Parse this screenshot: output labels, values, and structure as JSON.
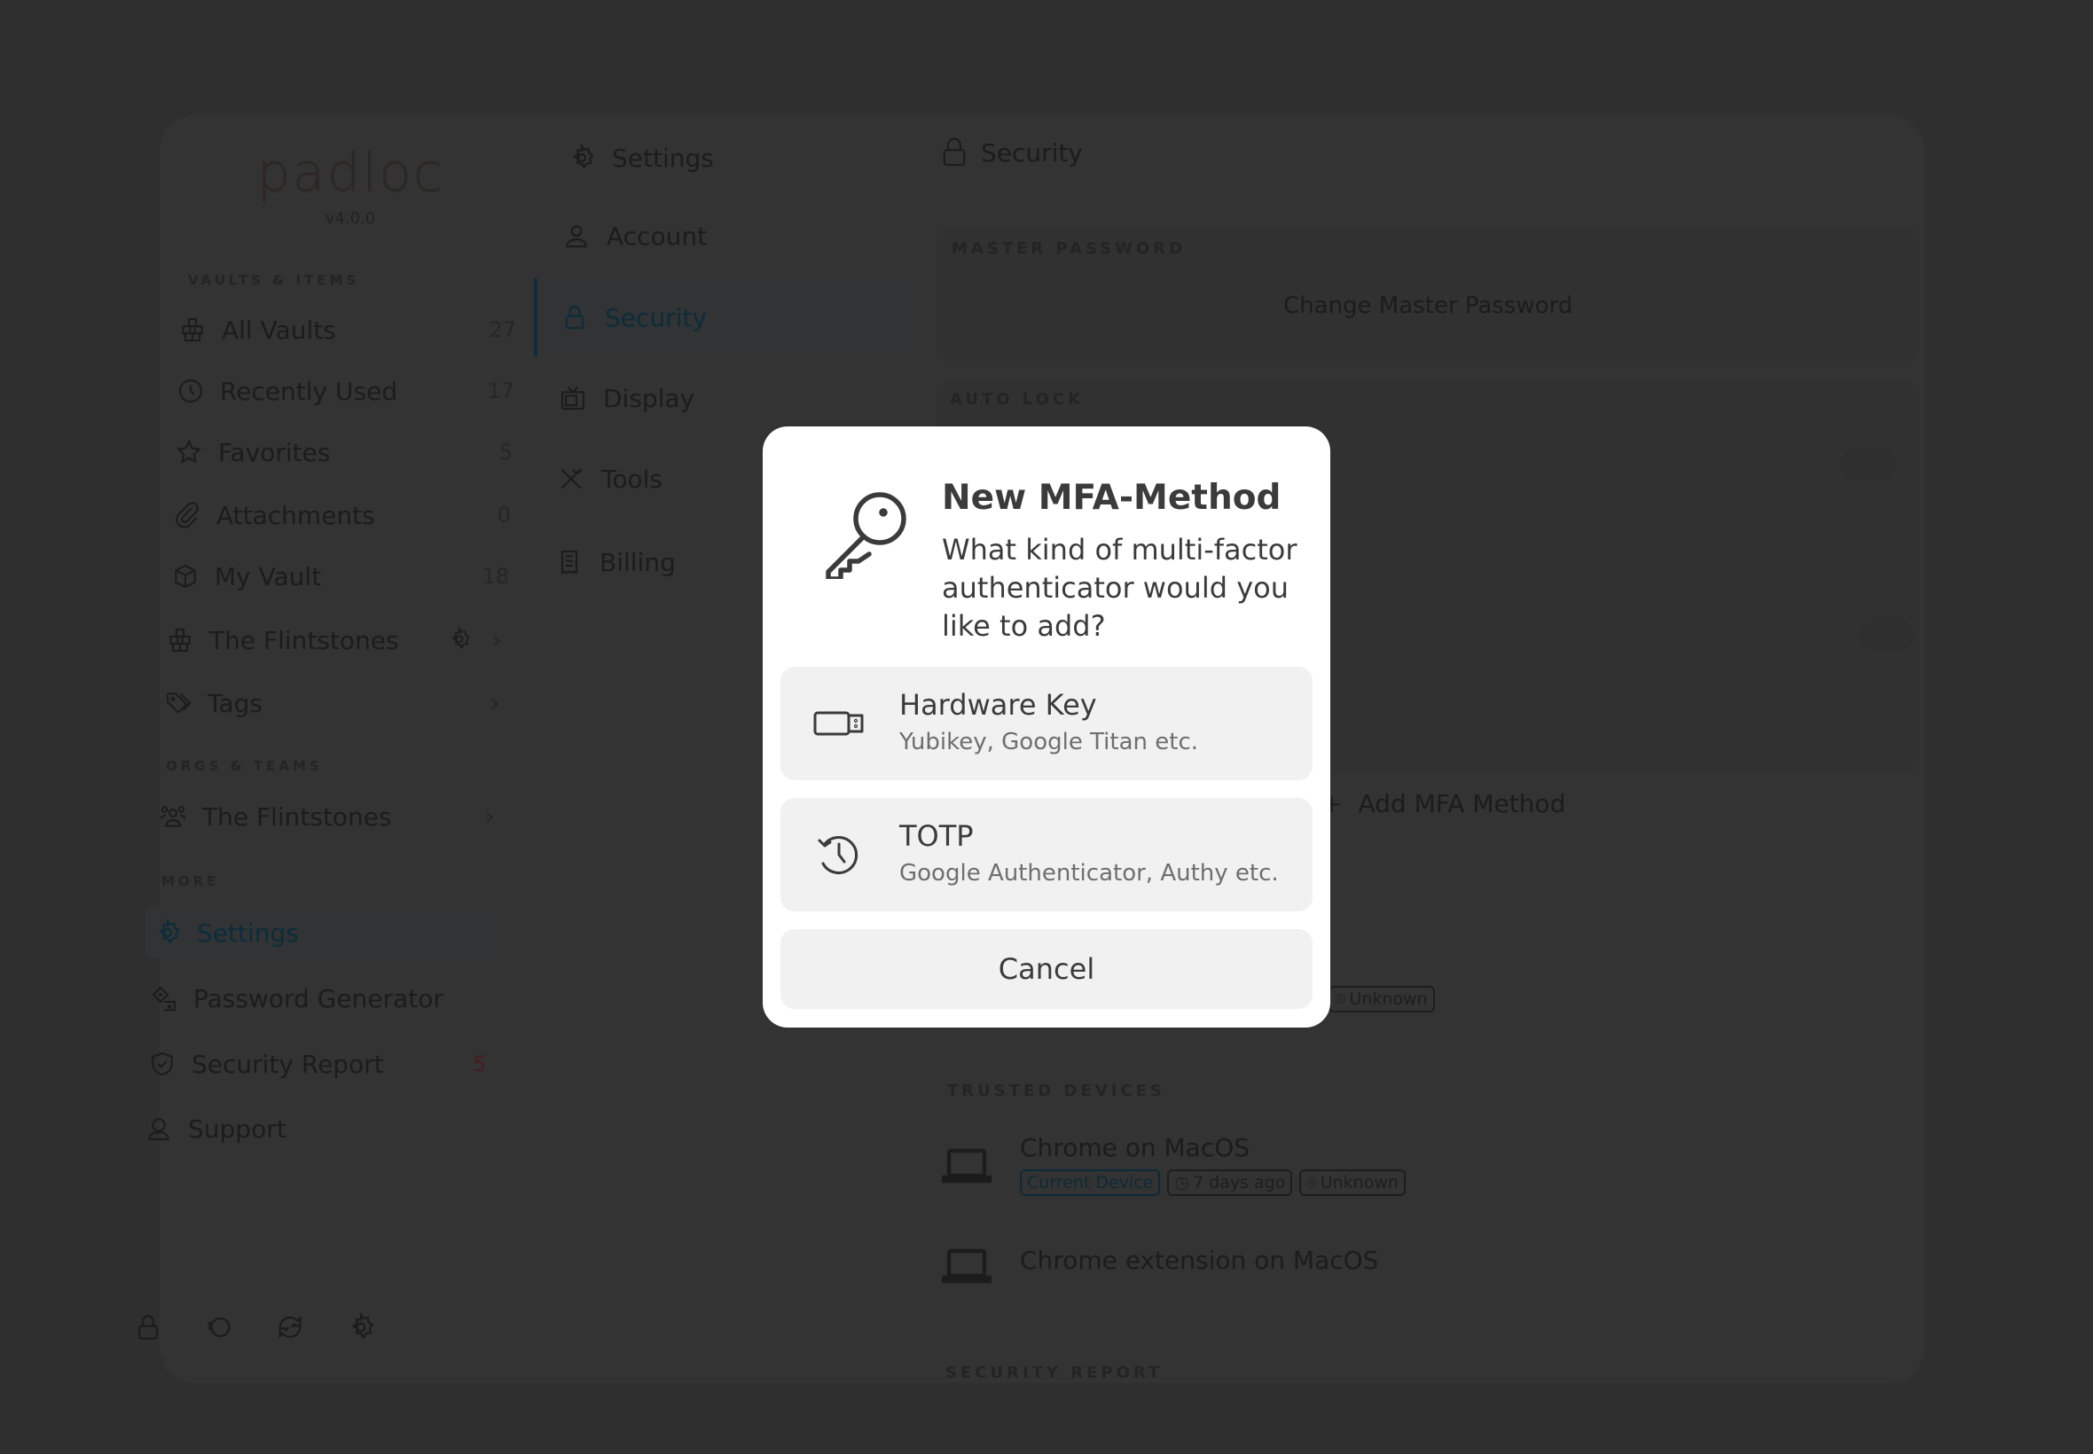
{
  "app": {
    "logo": "padloc",
    "version": "v4.0.0"
  },
  "sidebar": {
    "sections": {
      "vaults": "Vaults & Items",
      "orgs": "Orgs & Teams",
      "more": "More"
    },
    "items": [
      {
        "label": "All Vaults",
        "count": "27",
        "icon": "vaults-icon"
      },
      {
        "label": "Recently Used",
        "count": "17",
        "icon": "clock-icon"
      },
      {
        "label": "Favorites",
        "count": "5",
        "icon": "star-icon"
      },
      {
        "label": "Attachments",
        "count": "0",
        "icon": "paperclip-icon"
      },
      {
        "label": "My Vault",
        "count": "18",
        "icon": "cube-icon"
      },
      {
        "label": "The Flintstones",
        "icon": "vaults-icon"
      },
      {
        "label": "Tags",
        "icon": "tags-icon"
      },
      {
        "label": "The Flintstones",
        "icon": "group-icon"
      },
      {
        "label": "Settings",
        "icon": "gear-icon"
      },
      {
        "label": "Password Generator",
        "icon": "dice-icon"
      },
      {
        "label": "Security Report",
        "count": "5",
        "icon": "shield-check-icon"
      },
      {
        "label": "Support",
        "icon": "support-icon"
      }
    ],
    "chevron": "›",
    "security_count_color": "#4a1a1f"
  },
  "settings_nav": {
    "title": "Settings",
    "items": [
      {
        "label": "Account",
        "icon": "user-icon"
      },
      {
        "label": "Security",
        "icon": "lock-icon"
      },
      {
        "label": "Display",
        "icon": "tv-icon"
      },
      {
        "label": "Tools",
        "icon": "tools-icon"
      },
      {
        "label": "Billing",
        "icon": "receipt-icon"
      }
    ]
  },
  "security_page": {
    "title": "Security",
    "master_password_label": "Master Password",
    "change_master_password": "Change Master Password",
    "auto_lock_label": "Auto Lock",
    "add_mfa": "Add MFA Method",
    "add_mfa_prefix": "+",
    "mfa_badge_location": "Unknown",
    "trusted_devices_label": "Trusted Devices",
    "devices": [
      {
        "name": "Chrome on MacOS",
        "badges": {
          "current": "Current Device",
          "last_used": "7 days ago",
          "location": "Unknown"
        }
      },
      {
        "name": "Chrome extension on MacOS"
      }
    ],
    "security_report_label": "Security Report"
  },
  "modal": {
    "title": "New MFA-Method",
    "message": "What kind of multi-factor authenticator would you like to add?",
    "options": [
      {
        "title": "Hardware Key",
        "subtitle": "Yubikey, Google Titan etc.",
        "icon": "usb-key-icon"
      },
      {
        "title": "TOTP",
        "subtitle": "Google Authenticator, Authy etc.",
        "icon": "history-icon"
      }
    ],
    "cancel": "Cancel"
  },
  "colors": {
    "backdrop": "#2f2f2f",
    "modal_bg": "#ffffff",
    "option_bg": "#f1f1f1",
    "text": "#3b3b3b",
    "accent": "#0f2c3c"
  }
}
